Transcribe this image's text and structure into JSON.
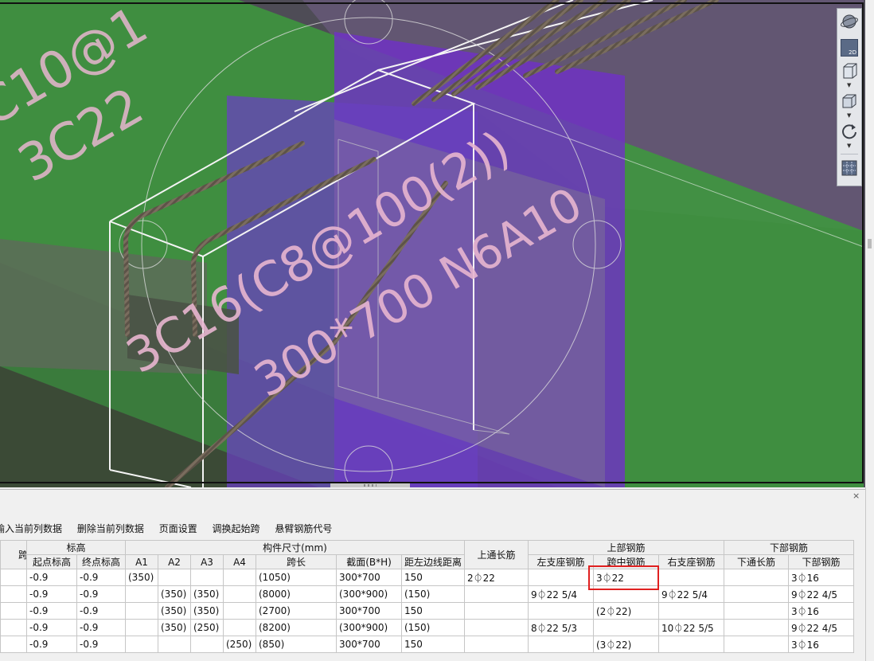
{
  "viewport": {
    "annotations": {
      "top_left_line1": "C10@1",
      "top_left_line2": "3C22",
      "main_stirrup": "3C16(C8@100(2))",
      "section_spec": "300*700 N6A10"
    },
    "toolbar": {
      "btn_orbit": "orbit-view",
      "btn_2d_label": "2D",
      "btn_3d_box": "3d-view",
      "btn_box": "box-view",
      "btn_rotate": "rotate-view",
      "btn_grid": "floor-grid"
    },
    "colors": {
      "background": "#4e4c56",
      "green_slab": "#3f9a3a",
      "purple_column": "#6a3cc4",
      "rebar_text": "#e8b6d0",
      "highlight_text": "#c6ee8a"
    }
  },
  "panel": {
    "close_glyph": "×",
    "toolbar_items": [
      "输入当前列数据",
      "删除当前列数据",
      "页面设置",
      "调换起始跨",
      "悬臂钢筋代号"
    ],
    "header_groups": {
      "g0": "跨号",
      "elevation": "标高",
      "dimensions": "构件尺寸(mm)",
      "top_through": "上通长筋",
      "top_rebar": "上部钢筋",
      "bottom_rebar": "下部钢筋"
    },
    "header_cols": {
      "start_elev": "起点标高",
      "end_elev": "终点标高",
      "a1": "A1",
      "a2": "A2",
      "a3": "A3",
      "a4": "A4",
      "span": "跨长",
      "section": "截面(B*H)",
      "offset": "距左边线距离",
      "left_support": "左支座钢筋",
      "mid_span": "跨中钢筋",
      "right_support": "右支座钢筋",
      "bottom_through": "下通长筋",
      "bottom_bars": "下部钢筋"
    },
    "rows": [
      [
        "",
        "-0.9",
        "-0.9",
        "(350)",
        "",
        "",
        "",
        "(1050)",
        "300*700",
        "150",
        "2⏀22",
        "",
        "3⏀22",
        "",
        "",
        "3⏀16"
      ],
      [
        "",
        "-0.9",
        "-0.9",
        "",
        "(350)",
        "(350)",
        "",
        "(8000)",
        "(300*900)",
        "(150)",
        "",
        "9⏀22 5/4",
        "",
        "9⏀22 5/4",
        "",
        "9⏀22 4/5"
      ],
      [
        "",
        "-0.9",
        "-0.9",
        "",
        "(350)",
        "(350)",
        "",
        "(2700)",
        "300*700",
        "150",
        "",
        "",
        "(2⏀22)",
        "",
        "",
        "3⏀16"
      ],
      [
        "",
        "-0.9",
        "-0.9",
        "",
        "(350)",
        "(250)",
        "",
        "(8200)",
        "(300*900)",
        "(150)",
        "",
        "8⏀22 5/3",
        "",
        "10⏀22 5/5",
        "",
        "9⏀22 4/5"
      ],
      [
        "",
        "-0.9",
        "-0.9",
        "",
        "",
        "",
        "(250)",
        "(850)",
        "300*700",
        "150",
        "",
        "",
        "(3⏀22)",
        "",
        "",
        "3⏀16"
      ]
    ]
  }
}
